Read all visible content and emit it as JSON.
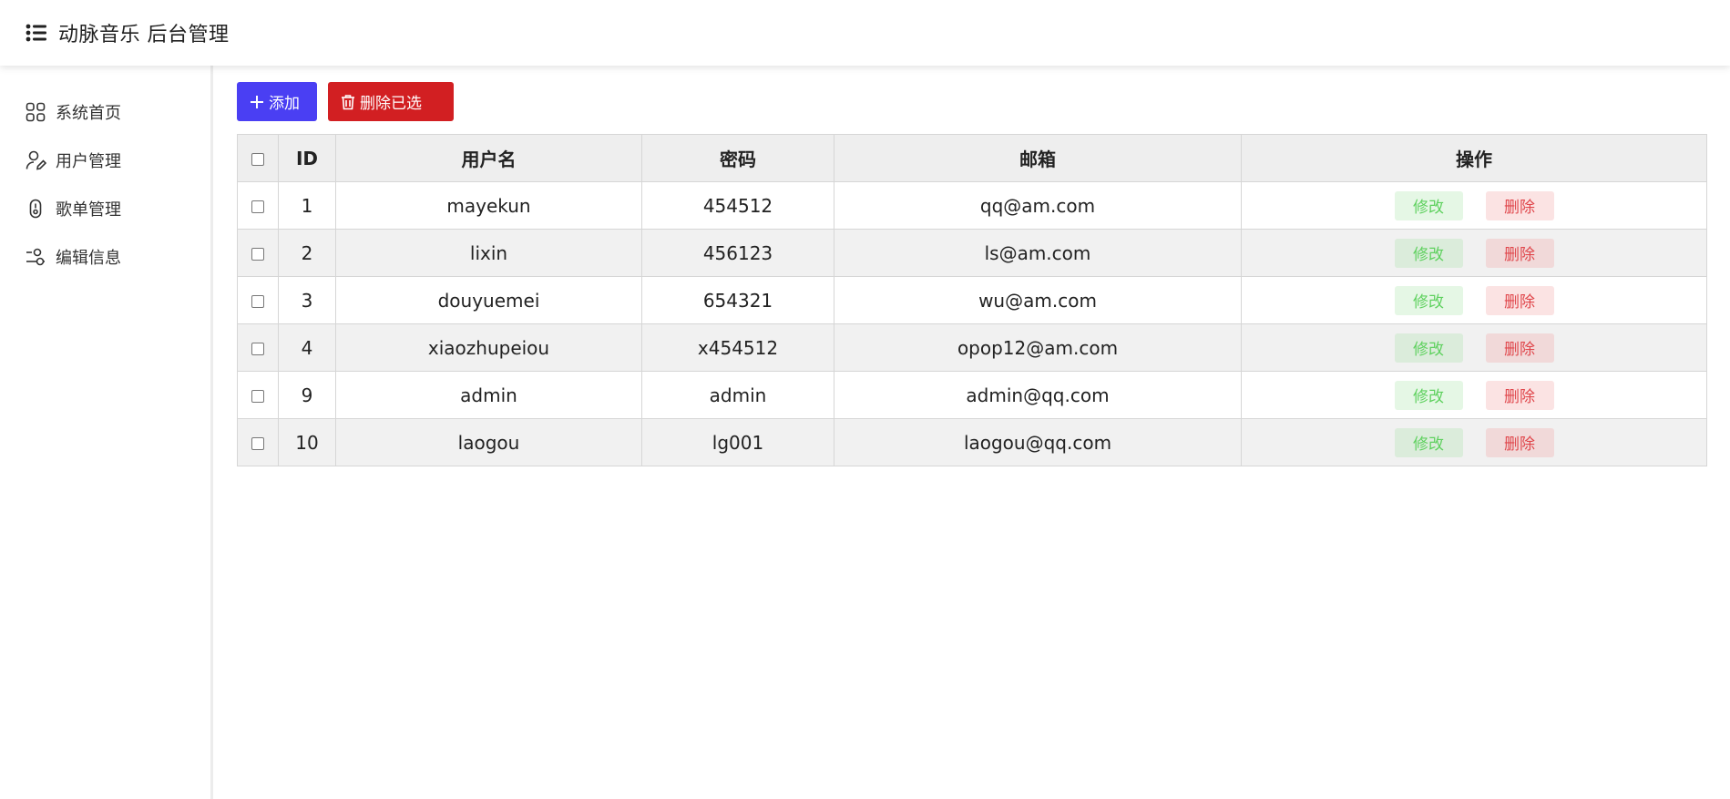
{
  "header": {
    "title": "动脉音乐 后台管理",
    "icon": "list-menu-icon"
  },
  "sidebar": {
    "items": [
      {
        "label": "系统首页",
        "icon": "grid-icon"
      },
      {
        "label": "用户管理",
        "icon": "user-edit-icon"
      },
      {
        "label": "歌单管理",
        "icon": "mic-icon"
      },
      {
        "label": "编辑信息",
        "icon": "sliders-icon"
      }
    ]
  },
  "toolbar": {
    "add_label": "添加",
    "delete_selected_label": "删除已选",
    "add_color": "#4a3ff3",
    "delete_color": "#d21f22"
  },
  "table": {
    "headers": {
      "id": "ID",
      "username": "用户名",
      "password": "密码",
      "email": "邮箱",
      "actions": "操作"
    },
    "edit_label": "修改",
    "delete_label": "删除",
    "rows": [
      {
        "id": "1",
        "username": "mayekun",
        "password": "454512",
        "email": "qq@am.com"
      },
      {
        "id": "2",
        "username": "lixin",
        "password": "456123",
        "email": "ls@am.com"
      },
      {
        "id": "3",
        "username": "douyuemei",
        "password": "654321",
        "email": "wu@am.com"
      },
      {
        "id": "4",
        "username": "xiaozhupeiou",
        "password": "x454512",
        "email": "opop12@am.com"
      },
      {
        "id": "9",
        "username": "admin",
        "password": "admin",
        "email": "admin@qq.com"
      },
      {
        "id": "10",
        "username": "laogou",
        "password": "lg001",
        "email": "laogou@qq.com"
      }
    ]
  }
}
